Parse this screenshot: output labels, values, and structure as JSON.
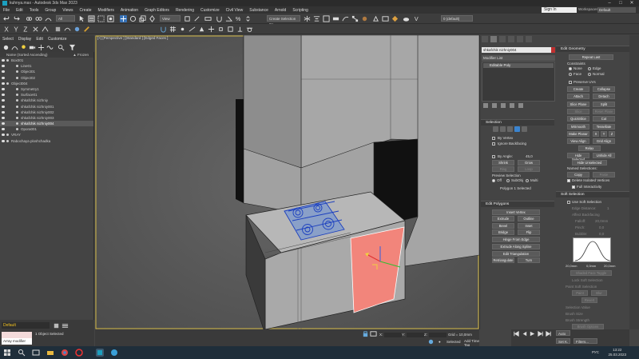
{
  "window": {
    "title": "kuhnya.max - Autodesk 3ds Max 2023"
  },
  "menu": {
    "items": [
      "File",
      "Edit",
      "Tools",
      "Group",
      "Views",
      "Create",
      "Modifiers",
      "Animation",
      "Graph Editors",
      "Rendering",
      "Customize",
      "Civil View",
      "Substance",
      "Arnold",
      "Scripting"
    ],
    "sign_in": "Sign In",
    "workspaces_label": "Workspaces:",
    "workspaces_value": "Default"
  },
  "toolbar": {
    "filter_value": "All",
    "view_value": "View",
    "selection_set": "Create Selection Se",
    "layer_value": "0 (default)"
  },
  "scene_explorer": {
    "tabs": [
      "Select",
      "Display",
      "Edit",
      "Customize"
    ],
    "header": "Name (Sorted Ascending)",
    "frozen_header": "▲ Frozen",
    "rows": [
      {
        "label": "Box001",
        "indent": 14,
        "selected": false
      },
      {
        "label": "Line01",
        "indent": 26,
        "selected": false
      },
      {
        "label": "Object01",
        "indent": 26,
        "selected": false
      },
      {
        "label": "Object02",
        "indent": 26,
        "selected": false
      },
      {
        "label": "Object004",
        "indent": 14,
        "selected": false
      },
      {
        "label": "Symmetry1",
        "indent": 26,
        "selected": false
      },
      {
        "label": "Surface01",
        "indent": 26,
        "selected": false
      },
      {
        "label": "shkafchik nizhniy",
        "indent": 26,
        "selected": false
      },
      {
        "label": "shkafchik nizhniy001",
        "indent": 26,
        "selected": false
      },
      {
        "label": "shkafchik nizhniy002",
        "indent": 26,
        "selected": false
      },
      {
        "label": "shkafchik nizhniy003",
        "indent": 26,
        "selected": false
      },
      {
        "label": "shkafchik nizhniy004",
        "indent": 26,
        "selected": true
      },
      {
        "label": "Opora001",
        "indent": 26,
        "selected": false
      },
      {
        "label": "VRAY",
        "indent": 14,
        "selected": false
      },
      {
        "label": "Rabochaya ploshchadka",
        "indent": 14,
        "selected": false
      }
    ],
    "layer_name": "Default",
    "maxscript_output": "",
    "array_modifier": "Array modifier"
  },
  "viewport": {
    "label": "[+] [Perspective ] [Standard ] [Edged Faces ]"
  },
  "status": {
    "objects_selected": "1 Object Selected",
    "x_label": "X:",
    "y_label": "Y:",
    "z_label": "Z:",
    "grid": "Grid = 10,0mm",
    "selected_label": "Selected",
    "add_time_tag": "Add Time Tag",
    "auto": "Auto",
    "setk": "Set K.",
    "filters": "Filters..."
  },
  "command_panel": {
    "object_name": "shkafchik nizhniy004",
    "modifier_list": "Modifier List",
    "stack_item": "Editable Poly",
    "selection": {
      "title": "Selection",
      "by_vertex": "By Vertex",
      "ignore_backfacing": "Ignore Backfacing",
      "by_angle": "By Angle:",
      "by_angle_value": "45,0",
      "shrink": "Shrink",
      "grow": "Grow",
      "ring": "Ring",
      "loop": "Loop",
      "preview_selection": "Preview Selection",
      "off": "Off",
      "subobj": "SubObj",
      "multi": "Multi",
      "status": "Polygon 1 Selected"
    },
    "edit_polygons": {
      "title": "Edit Polygons",
      "insert_vertex": "Insert Vertex",
      "extrude": "Extrude",
      "outline": "Outline",
      "bevel": "Bevel",
      "inset": "Inset",
      "bridge": "Bridge",
      "flip": "Flip",
      "hinge_from_edge": "Hinge From Edge",
      "extrude_along_spline": "Extrude Along Spline",
      "edit_triangulation": "Edit Triangulation",
      "retriangulate": "Retriangulate",
      "turn": "Turn"
    },
    "edit_geometry": {
      "title": "Edit Geometry",
      "repeat_last": "Repeat Last",
      "constraints": "Constraints",
      "none": "None",
      "edge": "Edge",
      "face": "Face",
      "normal": "Normal",
      "preserve_uvs": "Preserve UVs",
      "create": "Create",
      "collapse": "Collapse",
      "attach": "Attach",
      "detach": "Detach",
      "slice_plane": "Slice Plane",
      "split": "Split",
      "slice": "Slice",
      "reset_plane": "Reset Plane",
      "quickslice": "QuickSlice",
      "cut": "Cut",
      "msmooth": "MSmooth",
      "tessellate": "Tessellate",
      "make_planar": "Make Planar",
      "x": "X",
      "y": "Y",
      "z": "Z",
      "view_align": "View Align",
      "grid_align": "Grid Align",
      "relax": "Relax",
      "hide_selected": "Hide Selected",
      "unhide_all": "Unhide All",
      "hide_unselected": "Hide Unselected",
      "named_selections": "Named Selections:",
      "copy": "Copy",
      "paste": "Paste",
      "delete_isolated": "Delete Isolated Vertices",
      "full_interactivity": "Full Interactivity"
    },
    "soft_selection": {
      "title": "Soft Selection",
      "use_soft": "Use Soft Selection",
      "edge_distance": "Edge Distance:",
      "edge_distance_value": "1",
      "affect_backfacing": "Affect Backfacing",
      "falloff": "Falloff:",
      "falloff_value": "20,0mm",
      "pinch": "Pinch:",
      "pinch_value": "0,0",
      "bubble": "Bubble:",
      "bubble_value": "0,0",
      "curve_left": "20,0mm",
      "curve_mid": "0,0mm",
      "curve_right": "20,0mm",
      "shaded_face_toggle": "Shaded Face Toggle",
      "lock_soft": "Lock Soft Selection",
      "paint_soft": "Paint Soft Selection",
      "paint": "Paint",
      "blur": "Blur",
      "revert": "Revert",
      "selection_value": "Selection Value",
      "brush_size": "Brush Size",
      "brush_strength": "Brush Strength",
      "brush_options": "Brush Options"
    }
  },
  "taskbar": {
    "time": "13:22",
    "date": "25.03.2023",
    "lang": "РУС"
  },
  "colors": {
    "selected_face": "#f2857b",
    "accent": "#1b9fbf",
    "gizmo_x": "#e03030",
    "gizmo_y": "#30c030",
    "gizmo_z": "#3060e0"
  }
}
